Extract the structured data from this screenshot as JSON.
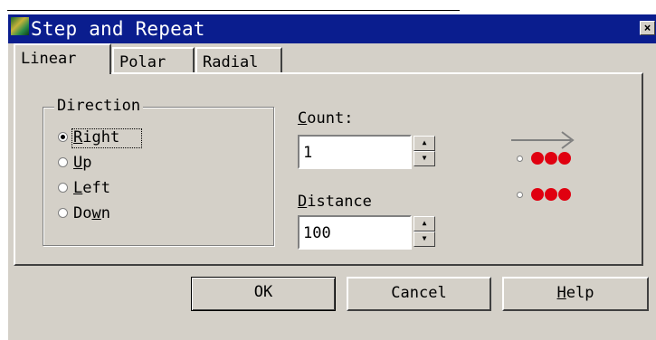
{
  "window": {
    "title": "Step and Repeat",
    "close_glyph": "×",
    "icon": "app-icon"
  },
  "tabs": [
    {
      "label": "Linear",
      "selected": true
    },
    {
      "label": "Polar",
      "selected": false
    },
    {
      "label": "Radial",
      "selected": false
    }
  ],
  "direction": {
    "legend": "Direction",
    "options": [
      {
        "label": "Right",
        "mnemonic": "R",
        "checked": true
      },
      {
        "label": "Up",
        "mnemonic": "U",
        "checked": false
      },
      {
        "label": "Left",
        "mnemonic": "L",
        "checked": false
      },
      {
        "label": "Down",
        "mnemonic": "w",
        "checked": false
      }
    ]
  },
  "count": {
    "label": "Count:",
    "mnemonic": "C",
    "value": "1"
  },
  "distance": {
    "label": "Distance",
    "mnemonic": "D",
    "value": "100"
  },
  "buttons": {
    "ok": "OK",
    "cancel": "Cancel",
    "help": "Help"
  },
  "colors": {
    "titlebar": "#0a1d8e",
    "face": "#d4d0c8",
    "dot_red": "#e00010",
    "arrow": "#808080"
  }
}
